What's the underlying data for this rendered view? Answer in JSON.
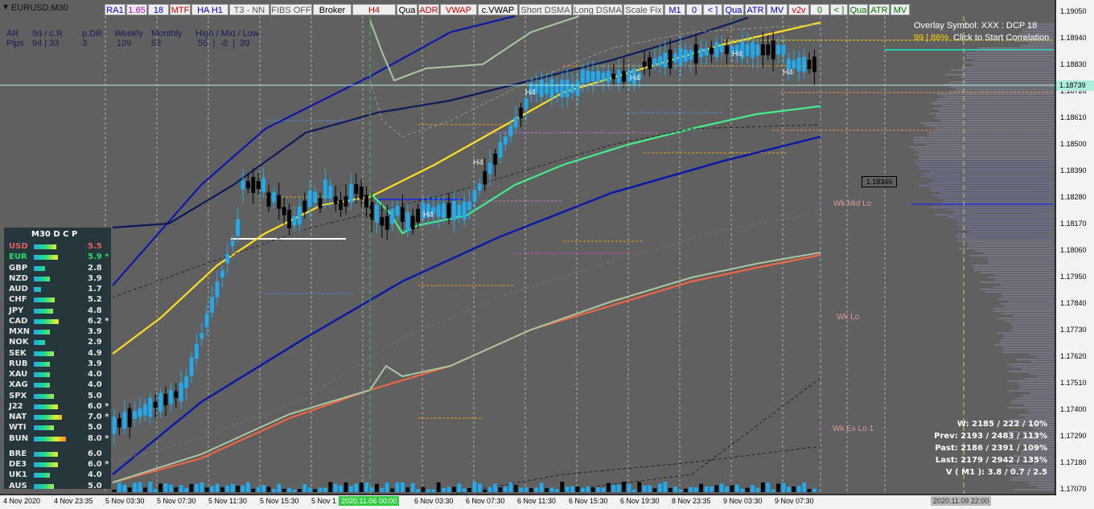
{
  "window": {
    "title": "EURUSD,M30"
  },
  "toolbar": [
    {
      "label": "RA1",
      "color": "#0000cc"
    },
    {
      "label": "1.65",
      "color": "#cc00cc"
    },
    {
      "label": "18",
      "color": "#0000cc"
    },
    {
      "label": "MTF",
      "color": "#cc0000"
    },
    {
      "label": "HA H1",
      "color": "#0000cc"
    },
    {
      "label": "T3 - NN",
      "color": "#555555"
    },
    {
      "label": "FIBS OFF",
      "color": "#555555"
    },
    {
      "label": "Broker",
      "color": "#000000"
    },
    {
      "label": "H4",
      "color": "#cc0000"
    },
    {
      "label": "Qua",
      "color": "#000000"
    },
    {
      "label": "ADR",
      "color": "#cc0000"
    },
    {
      "label": "VWAP",
      "color": "#cc0000"
    },
    {
      "label": "c.VWAP",
      "color": "#000000"
    },
    {
      "label": "Short DSMA",
      "color": "#555555"
    },
    {
      "label": "Long DSMA",
      "color": "#555555"
    },
    {
      "label": "Scale Fix",
      "color": "#555555"
    },
    {
      "label": "M1",
      "color": "#0000cc"
    },
    {
      "label": "0",
      "color": "#0000cc"
    },
    {
      "label": "< ]",
      "color": "#0000cc"
    },
    {
      "label": "Qua",
      "color": "#0000cc"
    },
    {
      "label": "ATR",
      "color": "#0000cc"
    },
    {
      "label": "MV",
      "color": "#0000cc"
    },
    {
      "label": "v2v",
      "color": "#cc0000"
    },
    {
      "label": "0",
      "color": "#007700"
    },
    {
      "label": "< ]",
      "color": "#007700"
    },
    {
      "label": "Qua",
      "color": "#007700"
    },
    {
      "label": "ATR",
      "color": "#007700"
    },
    {
      "label": "MV",
      "color": "#007700"
    }
  ],
  "stats": {
    "row1": [
      "AR",
      "9d / c.R",
      "p.DR",
      "Weekly",
      "Monthly",
      "High / Mid / Low"
    ],
    "row2": [
      "Pips",
      "94 | 33",
      "3",
      "109",
      "63",
      "55  |  -8  |  39"
    ]
  },
  "overlay": {
    "line1": "Overlay Symbol: XXX : DCP 18",
    "line2_prefix": "99 | 86%",
    "line2_action": "Click to Start Correlation"
  },
  "price_axis": {
    "labels": [
      "1.19050",
      "1.18940",
      "1.18830",
      "1.18720",
      "1.18610",
      "1.18500",
      "1.18390",
      "1.18280",
      "1.18170",
      "1.18060",
      "1.17950",
      "1.17840",
      "1.17730",
      "1.17620",
      "1.17510",
      "1.17400",
      "1.17290",
      "1.17180",
      "1.17070"
    ],
    "current_price": "1.18739",
    "marker_price": "1.18346"
  },
  "time_axis": {
    "labels": [
      "4 Nov 2020",
      "4 Nov 23:35",
      "5 Nov 03:30",
      "5 Nov 07:30",
      "5 Nov 11:30",
      "5 Nov 15:30",
      "5 Nov 1",
      "6 Nov 03:30",
      "6 Nov 07:30",
      "6 Nov 11:30",
      "6 Nov 15:30",
      "6 Nov 19:30",
      "8 Nov 23:35",
      "9 Nov 03:30",
      "9 Nov 07:30"
    ],
    "marker1": "2020.11.06 00:00",
    "marker2": "2020.11.09 22:00"
  },
  "weekly_labels": [
    "Wk Mid Lo",
    "Wk Lo",
    "Wk Ex Lo 1"
  ],
  "period_marker": "H4",
  "dcp": {
    "title": "M30  D C P",
    "rows": [
      {
        "cur": "USD",
        "val": "5.5",
        "fill": 0.55,
        "color": "#e06060",
        "star": ""
      },
      {
        "cur": "EUR",
        "val": "5.9 *",
        "fill": 0.59,
        "color": "#22dd66",
        "star": "*"
      },
      {
        "cur": "GBP",
        "val": "2.8",
        "fill": 0.28,
        "color": "#e6e6e6",
        "star": ""
      },
      {
        "cur": "NZD",
        "val": "3.9",
        "fill": 0.39,
        "color": "#e6e6e6",
        "star": ""
      },
      {
        "cur": "AUD",
        "val": "1.7",
        "fill": 0.17,
        "color": "#e6e6e6",
        "star": ""
      },
      {
        "cur": "CHF",
        "val": "5.2",
        "fill": 0.52,
        "color": "#e6e6e6",
        "star": ""
      },
      {
        "cur": "JPY",
        "val": "4.8",
        "fill": 0.48,
        "color": "#e6e6e6",
        "star": ""
      },
      {
        "cur": "CAD",
        "val": "6.2 *",
        "fill": 0.62,
        "color": "#e6e6e6",
        "star": "*"
      },
      {
        "cur": "MXN",
        "val": "3.9",
        "fill": 0.39,
        "color": "#e6e6e6",
        "star": ""
      },
      {
        "cur": "NOK",
        "val": "2.9",
        "fill": 0.29,
        "color": "#e6e6e6",
        "star": ""
      },
      {
        "cur": "SEK",
        "val": "4.9",
        "fill": 0.49,
        "color": "#e6e6e6",
        "star": ""
      },
      {
        "cur": "RUB",
        "val": "3.9",
        "fill": 0.39,
        "color": "#e6e6e6",
        "star": ""
      },
      {
        "cur": "XAU",
        "val": "4.0",
        "fill": 0.4,
        "color": "#e6e6e6",
        "star": ""
      },
      {
        "cur": "XAG",
        "val": "4.0",
        "fill": 0.4,
        "color": "#e6e6e6",
        "star": ""
      },
      {
        "cur": "SPX",
        "val": "5.0",
        "fill": 0.5,
        "color": "#e6e6e6",
        "star": ""
      },
      {
        "cur": "J22",
        "val": "6.0 *",
        "fill": 0.6,
        "color": "#e6e6e6",
        "star": "*"
      },
      {
        "cur": "NAT",
        "val": "7.0 *",
        "fill": 0.7,
        "color": "#e6e6e6",
        "star": "*"
      },
      {
        "cur": "WTI",
        "val": "5.0",
        "fill": 0.5,
        "color": "#e6e6e6",
        "star": ""
      },
      {
        "cur": "BUN",
        "val": "8.0 *",
        "fill": 0.8,
        "color": "#e6e6e6",
        "star": "*"
      },
      {
        "cur": "BRE",
        "val": "6.0",
        "fill": 0.6,
        "color": "#e6e6e6",
        "star": ""
      },
      {
        "cur": "DE3",
        "val": "6.0 *",
        "fill": 0.6,
        "color": "#e6e6e6",
        "star": "*"
      },
      {
        "cur": "UK1",
        "val": "4.0",
        "fill": 0.4,
        "color": "#e6e6e6",
        "star": ""
      },
      {
        "cur": "AUS",
        "val": "5.0",
        "fill": 0.5,
        "color": "#e6e6e6",
        "star": ""
      }
    ]
  },
  "volume": {
    "lines": [
      "W: 2185 / 222 / 10%",
      "Prev: 2193 / 2483 / 113%",
      "Past: 2186 / 2391 / 109%",
      "Last: 2179 / 2942 / 135%",
      "V ( M1 ): 3.8 / 0.7 / 2.5"
    ]
  },
  "colors": {
    "background": "#606060",
    "candle_bull": "#22aaee",
    "candle_bear": "#000000",
    "band_outer": "#0a1aa8",
    "band_mid": "#0a1a5a",
    "vwap": "#ffdd22",
    "ema_green": "#44ee88",
    "sma_red": "#ee6644"
  }
}
